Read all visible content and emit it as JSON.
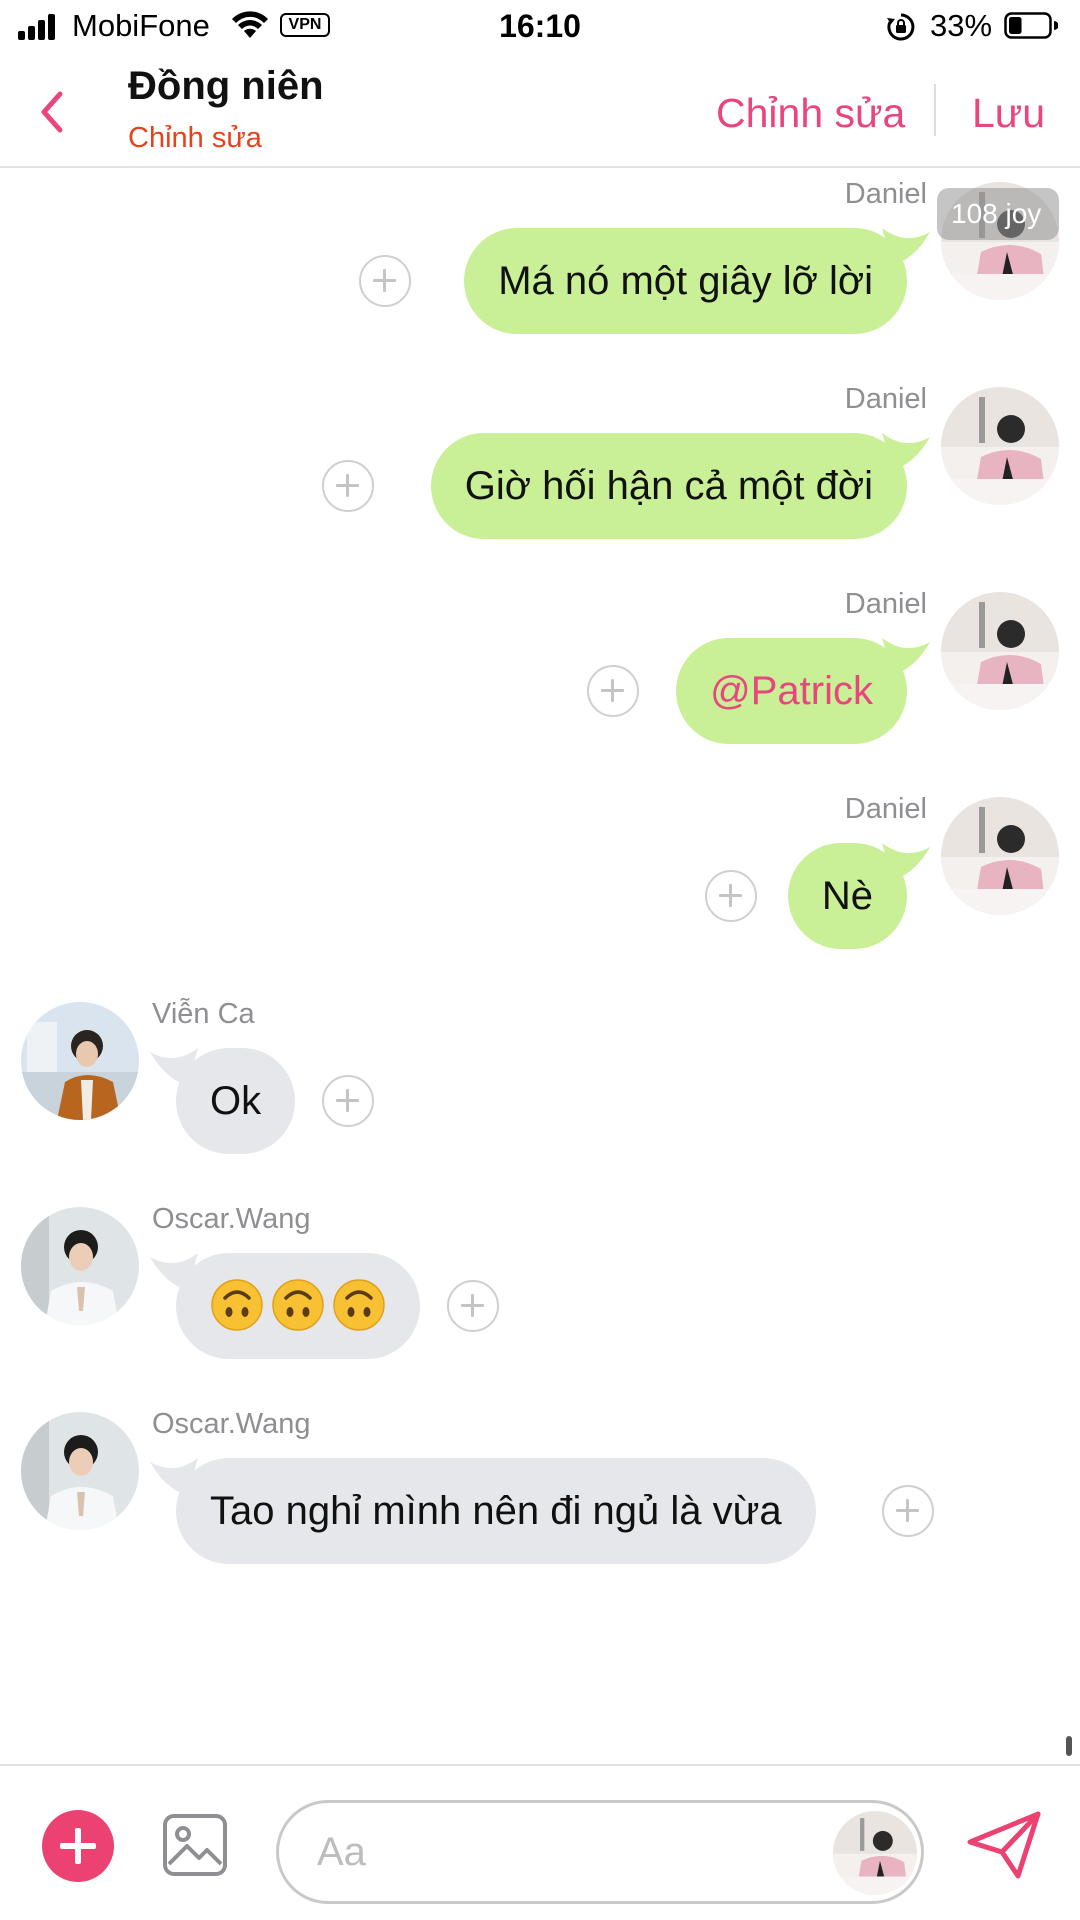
{
  "status_bar": {
    "carrier": "MobiFone",
    "vpn": "VPN",
    "time": "16:10",
    "battery_percent": "33%",
    "battery_level": 0.33
  },
  "header": {
    "title": "Đồng niên",
    "subtitle": "Chỉnh sửa",
    "edit_label": "Chỉnh sửa",
    "save_label": "Lưu"
  },
  "messages": [
    {
      "side": "right",
      "sender": "Daniel",
      "text": "Má nó một giây lỡ lời",
      "badge": "108 joy"
    },
    {
      "side": "right",
      "sender": "Daniel",
      "text": "Giờ hối hận cả một đời"
    },
    {
      "side": "right",
      "sender": "Daniel",
      "text": "@Patrick"
    },
    {
      "side": "right",
      "sender": "Daniel",
      "text": "Nè"
    },
    {
      "side": "left",
      "sender": "Viễn Ca",
      "text": "Ok"
    },
    {
      "side": "left",
      "sender": "Oscar.Wang",
      "text": "🙃🙃🙃"
    },
    {
      "side": "left",
      "sender": "Oscar.Wang",
      "text": "Tao nghỉ mình nên đi ngủ là vừa"
    }
  ],
  "composer": {
    "placeholder": "Aa"
  },
  "colors": {
    "accent": "#e8467c",
    "subtitle": "#e8411c",
    "outgoing_bubble": "#c9ef97",
    "incoming_bubble": "#e5e7ea"
  }
}
